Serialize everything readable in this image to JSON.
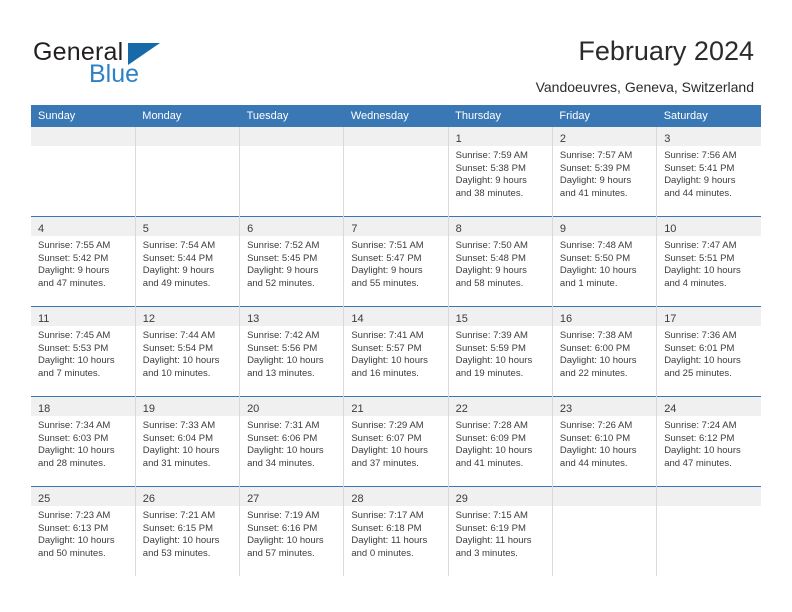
{
  "brand": {
    "name_top": "General",
    "name_bottom": "Blue",
    "triangle_color": "#1769a8",
    "blue_color": "#2e81c6"
  },
  "header": {
    "title": "February 2024",
    "subtitle": "Vandoeuvres, Geneva, Switzerland"
  },
  "theme": {
    "header_bar": "#3a78b5",
    "daynum_strip": "#f0f0f0",
    "grid_line": "#d9d9d9",
    "text": "#3c3c3c"
  },
  "weekday_headers": [
    "Sunday",
    "Monday",
    "Tuesday",
    "Wednesday",
    "Thursday",
    "Friday",
    "Saturday"
  ],
  "weeks": [
    [
      {
        "day": "",
        "lines": []
      },
      {
        "day": "",
        "lines": []
      },
      {
        "day": "",
        "lines": []
      },
      {
        "day": "",
        "lines": []
      },
      {
        "day": "1",
        "lines": [
          "Sunrise: 7:59 AM",
          "Sunset: 5:38 PM",
          "Daylight: 9 hours",
          "and 38 minutes."
        ]
      },
      {
        "day": "2",
        "lines": [
          "Sunrise: 7:57 AM",
          "Sunset: 5:39 PM",
          "Daylight: 9 hours",
          "and 41 minutes."
        ]
      },
      {
        "day": "3",
        "lines": [
          "Sunrise: 7:56 AM",
          "Sunset: 5:41 PM",
          "Daylight: 9 hours",
          "and 44 minutes."
        ]
      }
    ],
    [
      {
        "day": "4",
        "lines": [
          "Sunrise: 7:55 AM",
          "Sunset: 5:42 PM",
          "Daylight: 9 hours",
          "and 47 minutes."
        ]
      },
      {
        "day": "5",
        "lines": [
          "Sunrise: 7:54 AM",
          "Sunset: 5:44 PM",
          "Daylight: 9 hours",
          "and 49 minutes."
        ]
      },
      {
        "day": "6",
        "lines": [
          "Sunrise: 7:52 AM",
          "Sunset: 5:45 PM",
          "Daylight: 9 hours",
          "and 52 minutes."
        ]
      },
      {
        "day": "7",
        "lines": [
          "Sunrise: 7:51 AM",
          "Sunset: 5:47 PM",
          "Daylight: 9 hours",
          "and 55 minutes."
        ]
      },
      {
        "day": "8",
        "lines": [
          "Sunrise: 7:50 AM",
          "Sunset: 5:48 PM",
          "Daylight: 9 hours",
          "and 58 minutes."
        ]
      },
      {
        "day": "9",
        "lines": [
          "Sunrise: 7:48 AM",
          "Sunset: 5:50 PM",
          "Daylight: 10 hours",
          "and 1 minute."
        ]
      },
      {
        "day": "10",
        "lines": [
          "Sunrise: 7:47 AM",
          "Sunset: 5:51 PM",
          "Daylight: 10 hours",
          "and 4 minutes."
        ]
      }
    ],
    [
      {
        "day": "11",
        "lines": [
          "Sunrise: 7:45 AM",
          "Sunset: 5:53 PM",
          "Daylight: 10 hours",
          "and 7 minutes."
        ]
      },
      {
        "day": "12",
        "lines": [
          "Sunrise: 7:44 AM",
          "Sunset: 5:54 PM",
          "Daylight: 10 hours",
          "and 10 minutes."
        ]
      },
      {
        "day": "13",
        "lines": [
          "Sunrise: 7:42 AM",
          "Sunset: 5:56 PM",
          "Daylight: 10 hours",
          "and 13 minutes."
        ]
      },
      {
        "day": "14",
        "lines": [
          "Sunrise: 7:41 AM",
          "Sunset: 5:57 PM",
          "Daylight: 10 hours",
          "and 16 minutes."
        ]
      },
      {
        "day": "15",
        "lines": [
          "Sunrise: 7:39 AM",
          "Sunset: 5:59 PM",
          "Daylight: 10 hours",
          "and 19 minutes."
        ]
      },
      {
        "day": "16",
        "lines": [
          "Sunrise: 7:38 AM",
          "Sunset: 6:00 PM",
          "Daylight: 10 hours",
          "and 22 minutes."
        ]
      },
      {
        "day": "17",
        "lines": [
          "Sunrise: 7:36 AM",
          "Sunset: 6:01 PM",
          "Daylight: 10 hours",
          "and 25 minutes."
        ]
      }
    ],
    [
      {
        "day": "18",
        "lines": [
          "Sunrise: 7:34 AM",
          "Sunset: 6:03 PM",
          "Daylight: 10 hours",
          "and 28 minutes."
        ]
      },
      {
        "day": "19",
        "lines": [
          "Sunrise: 7:33 AM",
          "Sunset: 6:04 PM",
          "Daylight: 10 hours",
          "and 31 minutes."
        ]
      },
      {
        "day": "20",
        "lines": [
          "Sunrise: 7:31 AM",
          "Sunset: 6:06 PM",
          "Daylight: 10 hours",
          "and 34 minutes."
        ]
      },
      {
        "day": "21",
        "lines": [
          "Sunrise: 7:29 AM",
          "Sunset: 6:07 PM",
          "Daylight: 10 hours",
          "and 37 minutes."
        ]
      },
      {
        "day": "22",
        "lines": [
          "Sunrise: 7:28 AM",
          "Sunset: 6:09 PM",
          "Daylight: 10 hours",
          "and 41 minutes."
        ]
      },
      {
        "day": "23",
        "lines": [
          "Sunrise: 7:26 AM",
          "Sunset: 6:10 PM",
          "Daylight: 10 hours",
          "and 44 minutes."
        ]
      },
      {
        "day": "24",
        "lines": [
          "Sunrise: 7:24 AM",
          "Sunset: 6:12 PM",
          "Daylight: 10 hours",
          "and 47 minutes."
        ]
      }
    ],
    [
      {
        "day": "25",
        "lines": [
          "Sunrise: 7:23 AM",
          "Sunset: 6:13 PM",
          "Daylight: 10 hours",
          "and 50 minutes."
        ]
      },
      {
        "day": "26",
        "lines": [
          "Sunrise: 7:21 AM",
          "Sunset: 6:15 PM",
          "Daylight: 10 hours",
          "and 53 minutes."
        ]
      },
      {
        "day": "27",
        "lines": [
          "Sunrise: 7:19 AM",
          "Sunset: 6:16 PM",
          "Daylight: 10 hours",
          "and 57 minutes."
        ]
      },
      {
        "day": "28",
        "lines": [
          "Sunrise: 7:17 AM",
          "Sunset: 6:18 PM",
          "Daylight: 11 hours",
          "and 0 minutes."
        ]
      },
      {
        "day": "29",
        "lines": [
          "Sunrise: 7:15 AM",
          "Sunset: 6:19 PM",
          "Daylight: 11 hours",
          "and 3 minutes."
        ]
      },
      {
        "day": "",
        "lines": []
      },
      {
        "day": "",
        "lines": []
      }
    ]
  ]
}
